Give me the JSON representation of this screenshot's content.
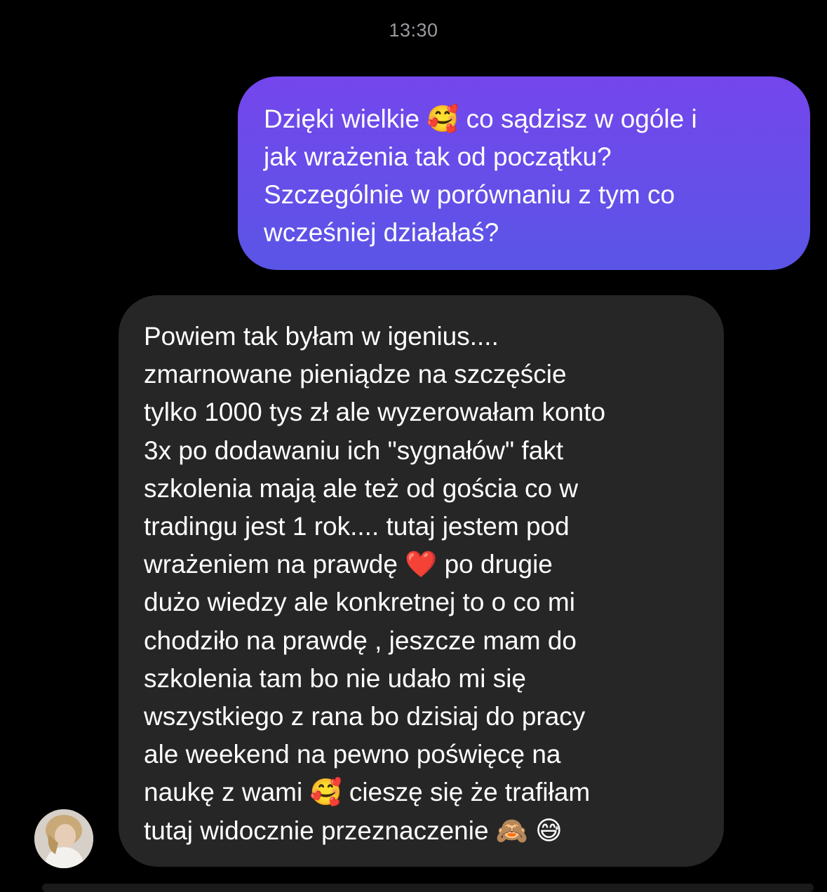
{
  "chat": {
    "timestamp": "13:30",
    "outgoing": {
      "lines": [
        "Dzięki wielkie 🥰 co sądzisz w ogóle i",
        "jak wrażenia tak od początku?",
        "Szczególnie w porównaniu z tym co",
        "wcześniej działałaś?"
      ]
    },
    "incoming": {
      "lines": [
        "Powiem tak byłam w igenius....",
        "zmarnowane pieniądze na szczęście",
        "tylko 1000 tys zł ale wyzerowałam konto",
        "3x po dodawaniu ich \"sygnałów\" fakt",
        "szkolenia mają ale też od gościa co w",
        "tradingu jest 1 rok.... tutaj jestem pod",
        "wrażeniem na prawdę ❤️ po drugie",
        "dużo wiedzy ale konkretnej to o co mi",
        "chodziło na prawdę , jeszcze mam do",
        "szkolenia tam bo nie udało mi się",
        "wszystkiego z rana bo dzisiaj do pracy",
        "ale weekend na pewno poświęcę na",
        "naukę z wami 🥰 cieszę się że trafiłam",
        "tutaj widocznie przeznaczenie 🙈 😅"
      ]
    }
  },
  "colors": {
    "background": "#000000",
    "outgoing_bubble_top": "#7446ec",
    "outgoing_bubble_bottom": "#5a55e6",
    "incoming_bubble": "#262626",
    "timestamp_text": "#9a9aa0"
  },
  "icons": {
    "avatar": "sender-avatar"
  }
}
